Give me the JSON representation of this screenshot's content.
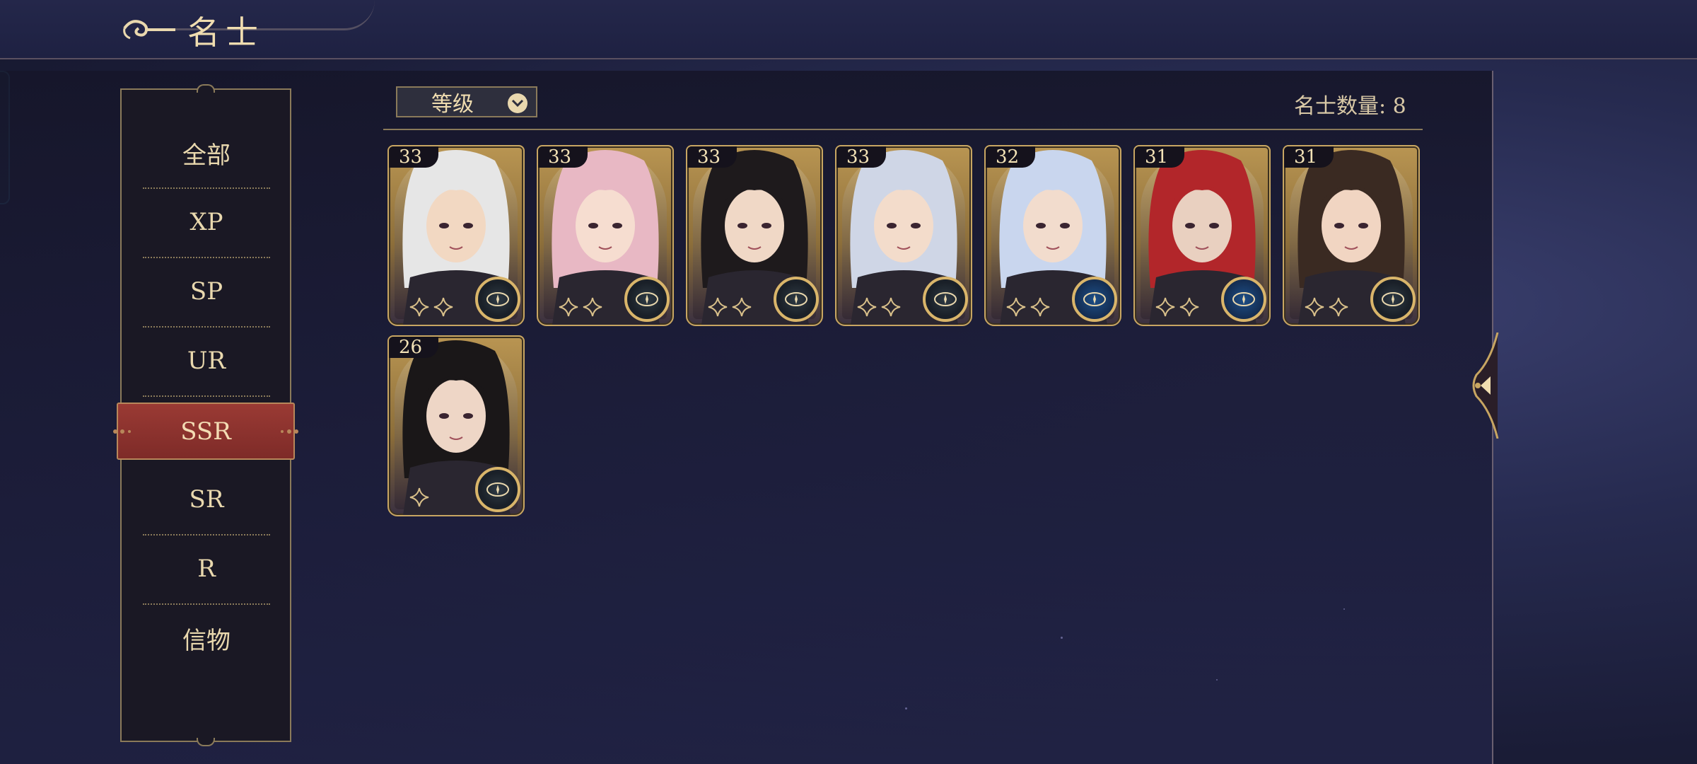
{
  "header": {
    "title": "名士"
  },
  "sidebar": {
    "categories": [
      {
        "label": "全部"
      },
      {
        "label": "XP"
      },
      {
        "label": "SP"
      },
      {
        "label": "UR"
      },
      {
        "label": "SSR"
      },
      {
        "label": "SR"
      },
      {
        "label": "R"
      },
      {
        "label": "信物"
      }
    ],
    "active": "SSR"
  },
  "toolbar": {
    "sort_label": "等级",
    "count_text": "名士数量: 8"
  },
  "cards": [
    {
      "level": "33",
      "badge": "gold",
      "hair": "#e6e6e6",
      "skin": "#f2d8c2"
    },
    {
      "level": "33",
      "badge": "gold",
      "hair": "#e8b8c4",
      "skin": "#f6ddd0"
    },
    {
      "level": "33",
      "badge": "gold",
      "hair": "#1e1a1c",
      "skin": "#f0d8c6"
    },
    {
      "level": "33",
      "badge": "gold",
      "hair": "#cfd6e6",
      "skin": "#f3dccb"
    },
    {
      "level": "32",
      "badge": "blue",
      "hair": "#c9d6ee",
      "skin": "#f2dccd"
    },
    {
      "level": "31",
      "badge": "blue",
      "hair": "#b2262a",
      "skin": "#e9d0c0"
    },
    {
      "level": "31",
      "badge": "gold",
      "hair": "#3a2a22",
      "skin": "#f1d5c2"
    },
    {
      "level": "26",
      "badge": "gold",
      "hair": "#1a1718",
      "skin": "#eed6c6"
    }
  ],
  "colors": {
    "accent_gold": "#c8a662",
    "active_red": "#8e322e",
    "background": "#1c1e3a"
  },
  "icons": [
    "cloud-swirl-icon",
    "chevron-down-icon",
    "element-badge-icon",
    "star-icon",
    "collapse-arrow-icon"
  ]
}
